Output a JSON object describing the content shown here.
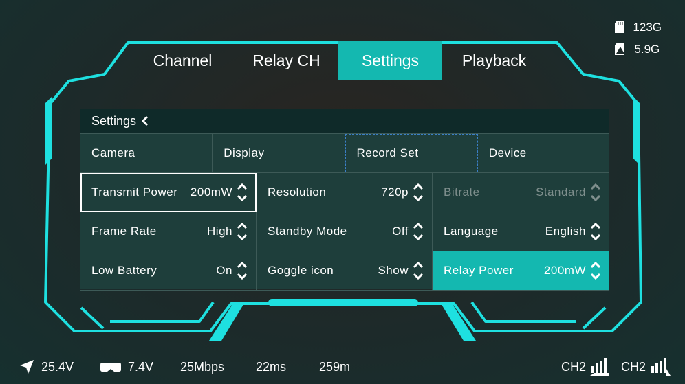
{
  "storage": {
    "sd_card": "123G",
    "goggle": "5.9G"
  },
  "tabs": [
    {
      "label": "Channel",
      "active": false
    },
    {
      "label": "Relay CH",
      "active": false
    },
    {
      "label": "Settings",
      "active": true
    },
    {
      "label": "Playback",
      "active": false
    }
  ],
  "panel": {
    "title": "Settings",
    "subtabs": [
      "Camera",
      "Display",
      "Record Set",
      "Device"
    ],
    "settings": [
      {
        "label": "Transmit Power",
        "value": "200mW",
        "state": "selected"
      },
      {
        "label": "Resolution",
        "value": "720p",
        "state": "normal"
      },
      {
        "label": "Bitrate",
        "value": "Standard",
        "state": "disabled"
      },
      {
        "label": "Frame Rate",
        "value": "High",
        "state": "normal"
      },
      {
        "label": "Standby Mode",
        "value": "Off",
        "state": "normal"
      },
      {
        "label": "Language",
        "value": "English",
        "state": "normal"
      },
      {
        "label": "Low Battery",
        "value": "On",
        "state": "normal"
      },
      {
        "label": "Goggle icon",
        "value": "Show",
        "state": "normal"
      },
      {
        "label": "Relay Power",
        "value": "200mW",
        "state": "highlight"
      }
    ]
  },
  "status": {
    "drone_voltage": "25.4V",
    "goggle_voltage": "7.4V",
    "bitrate": "25Mbps",
    "latency": "22ms",
    "distance": "259m",
    "ch_a": "CH2",
    "ch_b": "CH2"
  },
  "colors": {
    "accent": "#14b8b0",
    "frame": "#1ee0e0",
    "panel": "#1e3e3b"
  }
}
